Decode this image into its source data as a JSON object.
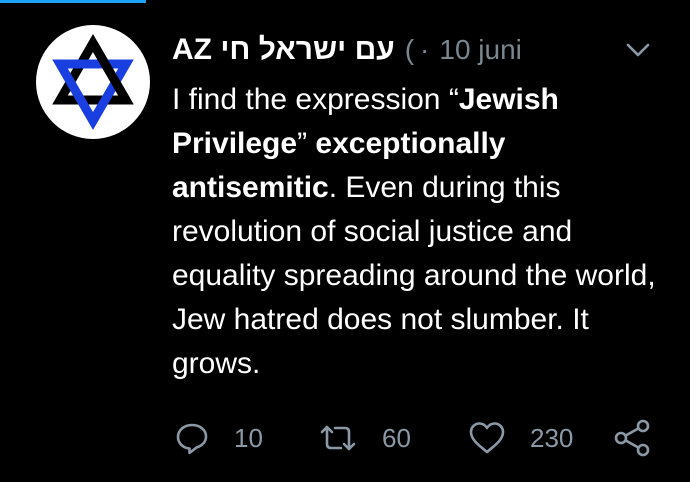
{
  "tweet": {
    "author": {
      "display_name": "AZ עם ישראל חי",
      "handle_truncated": "(",
      "avatar_icon": "star-of-david-icon"
    },
    "separator": "·",
    "timestamp": "10 juni",
    "body": {
      "t1": "I find the expression “",
      "b1": "Jewish Privilege",
      "t2": "” ",
      "b2": "exceptionally antisemitic",
      "t3": ". Even during this revolution of social justice and equality spreading around the world, Jew hatred does not slumber. It grows."
    },
    "actions": {
      "reply_count": "10",
      "retweet_count": "60",
      "like_count": "230"
    }
  },
  "icons": {
    "menu": "chevron-down-icon",
    "reply": "reply-icon",
    "retweet": "retweet-icon",
    "like": "heart-icon",
    "share": "share-icon"
  },
  "colors": {
    "background": "#000000",
    "text": "#ffffff",
    "muted": "#8b98a5",
    "accent": "#1da1f2",
    "star_blue": "#1a3fe0",
    "star_black": "#000000"
  }
}
